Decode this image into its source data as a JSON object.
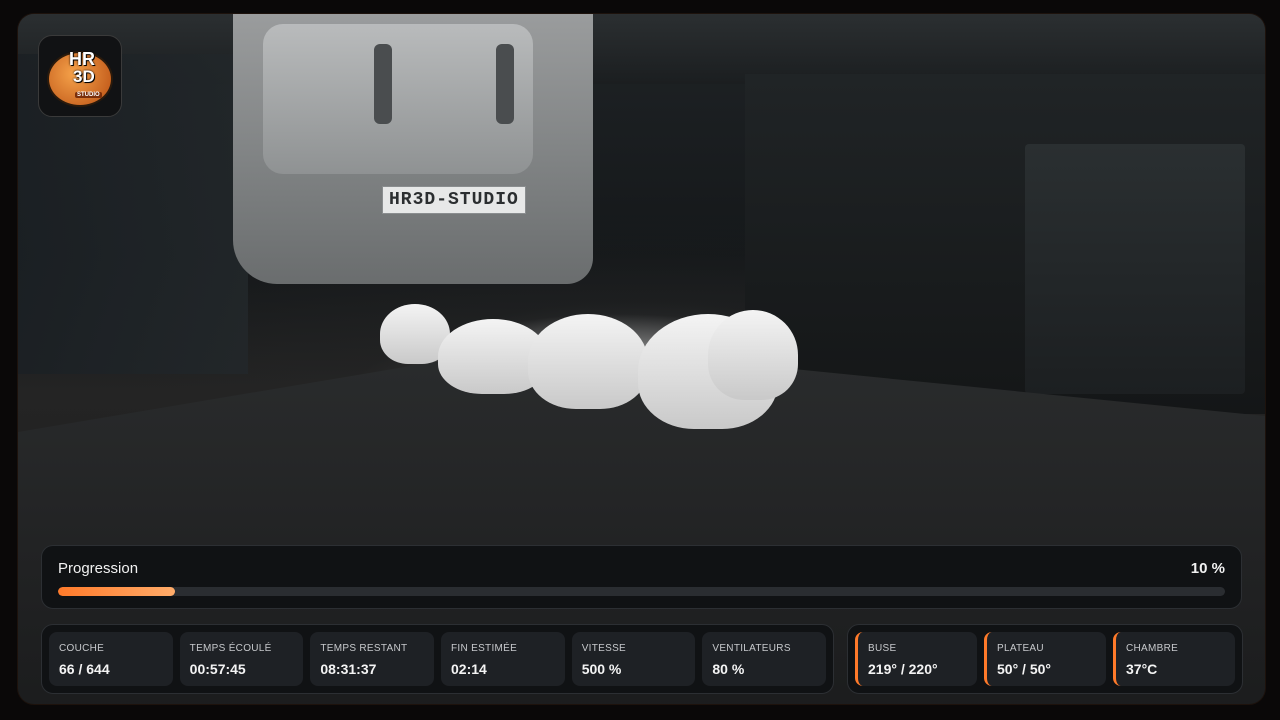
{
  "camera": {
    "toolhead_label": "HR3D-STUDIO"
  },
  "logo": {
    "line1": "HR",
    "line2": "3D",
    "line3": "STUDIO"
  },
  "progress": {
    "label": "Progression",
    "percent_text": "10 %",
    "value": 0.1
  },
  "stats": [
    {
      "label": "COUCHE",
      "value": "66 / 644"
    },
    {
      "label": "TEMPS ÉCOULÉ",
      "value": "00:57:45"
    },
    {
      "label": "TEMPS RESTANT",
      "value": "08:31:37"
    },
    {
      "label": "FIN ESTIMÉE",
      "value": "02:14"
    },
    {
      "label": "VITESSE",
      "value": "500 %"
    },
    {
      "label": "VENTILATEURS",
      "value": "80 %"
    }
  ],
  "temperatures": [
    {
      "label": "BUSE",
      "value": "219° / 220°"
    },
    {
      "label": "PLATEAU",
      "value": "50° / 50°"
    },
    {
      "label": "CHAMBRE",
      "value": "37°C"
    }
  ],
  "colors": {
    "accent": "#ff7a2a",
    "panel_bg": "#101214",
    "card_bg": "#1e2125"
  }
}
